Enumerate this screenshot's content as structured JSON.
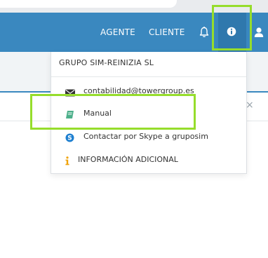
{
  "navbar": {
    "links": [
      "AGENTE",
      "CLIENTE"
    ],
    "icons": [
      "bell-icon",
      "info-icon",
      "user-icon"
    ],
    "color": "#3a88bf"
  },
  "dropdown": {
    "company": "GRUPO SIM-REINIZIA SL",
    "items": [
      {
        "label": "contabilidad@towergroup.es",
        "icon": "envelope-icon"
      },
      {
        "label": "Manual",
        "icon": "book-icon"
      },
      {
        "label": "Contactar por Skype a gruposim",
        "icon": "skype-icon"
      },
      {
        "label": "INFORMACIÓN ADICIONAL",
        "icon": "info-icon"
      }
    ]
  },
  "panel": {
    "close_glyph": "×"
  },
  "colors": {
    "highlight": "#96dd2c",
    "book": "#4caf8a",
    "skype": "#1e7fd0",
    "info": "#f0a30a"
  }
}
